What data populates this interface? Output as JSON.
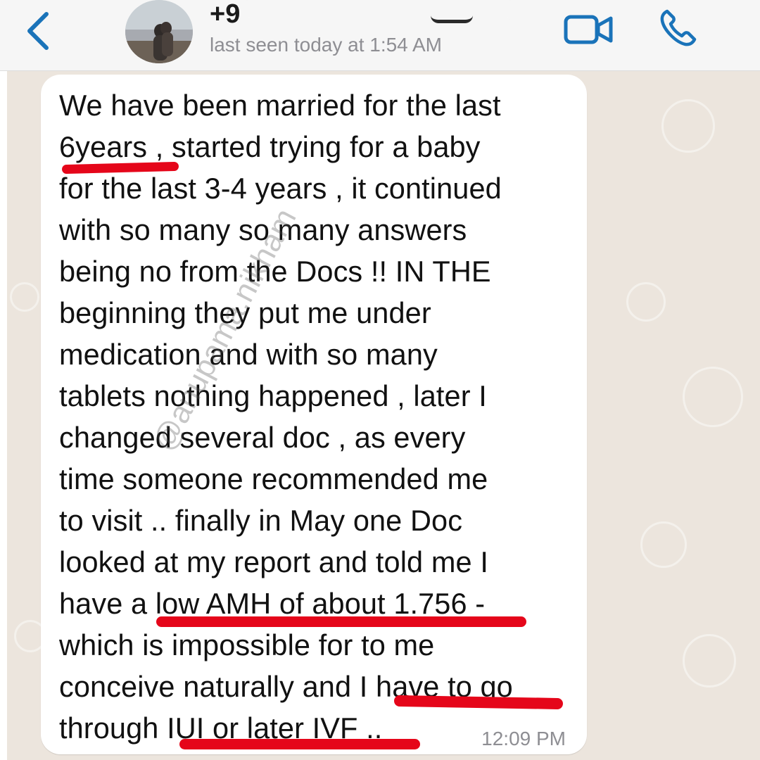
{
  "header": {
    "contact_name": "+9",
    "last_seen": "last seen today at 1:54 AM",
    "back_icon": "chevron-left-icon",
    "video_icon": "video-camera-icon",
    "call_icon": "phone-icon",
    "accent_color": "#1a73b9"
  },
  "message": {
    "text": "We have been married for the last\n6years , started trying for a baby\nfor the last 3-4 years , it continued\nwith so many so many answers\nbeing no from the Docs !!   IN THE\nbeginning they put me under\nmedication  and with so many\ntablets nothing happened , later I\nchanged several doc , as every\ntime someone recommended me\nto visit .. finally in May one Doc\nlooked at my report and told me I\nhave a low AMH of about 1.756 -\nwhich is impossible for to me\nconceive naturally and I have to go\nthrough IUI or later IVF ..",
    "time": "12:09 PM",
    "watermark": "@anupama.nikham",
    "highlight_color": "#e5061a"
  }
}
